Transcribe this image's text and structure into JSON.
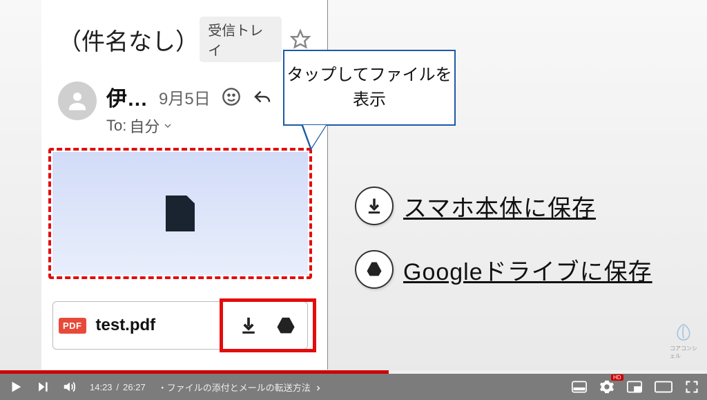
{
  "email": {
    "subject": "（件名なし）",
    "inbox_label": "受信トレイ",
    "sender_name": "伊…",
    "date": "9月5日",
    "to_prefix": "To:",
    "to_value": "自分",
    "attachment_filename": "test.pdf",
    "pdf_badge": "PDF"
  },
  "callout": {
    "text": "タップしてファイルを\n表示"
  },
  "legend": {
    "download": "スマホ本体に保存",
    "drive": "Googleドライブに保存"
  },
  "watermark": {
    "label": "コアコンシェル"
  },
  "player": {
    "current": "14:23",
    "total": "26:27",
    "separator": " / ",
    "chapter_prefix": "・",
    "chapter": "ファイルの添付とメールの転送方法",
    "hd_badge": "HD"
  }
}
